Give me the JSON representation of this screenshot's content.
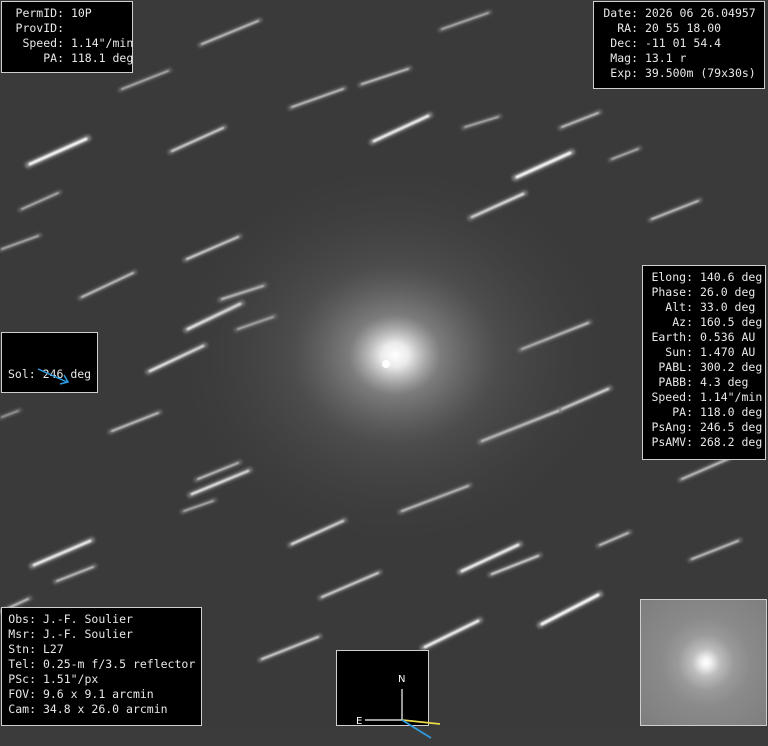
{
  "top_left": [
    {
      "label": "PermID:",
      "value": "10P"
    },
    {
      "label": "ProvID:",
      "value": ""
    },
    {
      "label": "Speed:",
      "value": "1.14\"/min"
    },
    {
      "label": "PA:",
      "value": "118.1 deg"
    }
  ],
  "top_right": [
    {
      "label": "Date:",
      "value": "2026 06 26.04957"
    },
    {
      "label": "RA:",
      "value": "20 55 18.00"
    },
    {
      "label": "Dec:",
      "value": "-11 01 54.4"
    },
    {
      "label": "Mag:",
      "value": "13.1 r"
    },
    {
      "label": "Exp:",
      "value": "39.500m (79x30s)"
    }
  ],
  "right_panel": [
    {
      "label": "Elong:",
      "value": "140.6 deg"
    },
    {
      "label": "Phase:",
      "value": "26.0 deg"
    },
    {
      "label": "Alt:",
      "value": "33.0 deg"
    },
    {
      "label": "Az:",
      "value": "160.5 deg"
    },
    {
      "label": "Earth:",
      "value": "0.536 AU"
    },
    {
      "label": "Sun:",
      "value": "1.470 AU"
    },
    {
      "label": "PABL:",
      "value": "300.2 deg"
    },
    {
      "label": "PABB:",
      "value": "4.3 deg"
    },
    {
      "label": "Speed:",
      "value": "1.14\"/min"
    },
    {
      "label": "PA:",
      "value": "118.0 deg"
    },
    {
      "label": "PsAng:",
      "value": "246.5 deg"
    },
    {
      "label": "PsAMV:",
      "value": "268.2 deg"
    }
  ],
  "sol": {
    "label": "Sol:",
    "value": "246 deg",
    "arrow_color": "#2f9be0"
  },
  "bottom_left": [
    {
      "label": "Obs:",
      "value": "J.-F. Soulier"
    },
    {
      "label": "Msr:",
      "value": "J.-F. Soulier"
    },
    {
      "label": "Stn:",
      "value": "L27"
    },
    {
      "label": "Tel:",
      "value": "0.25-m f/3.5 reflector"
    },
    {
      "label": "PSc:",
      "value": "1.51\"/px"
    },
    {
      "label": "FOV:",
      "value": "9.6 x 9.1 arcmin"
    },
    {
      "label": "Cam:",
      "value": "34.8 x 26.0 arcmin"
    }
  ],
  "compass": {
    "north": "N",
    "east": "E",
    "motion_color": "#e8d84a",
    "sun_color": "#2f9be0"
  }
}
